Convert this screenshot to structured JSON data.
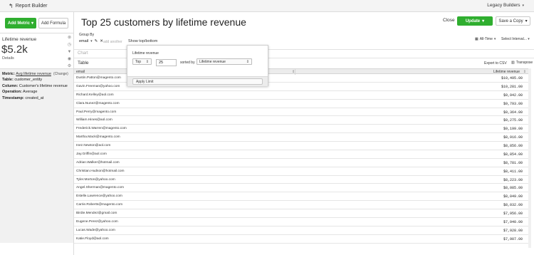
{
  "topbar": {
    "back_label": "Report Builder",
    "org_label": "Legacy Builders"
  },
  "sidebar": {
    "add_metric_label": "Add Metric",
    "add_formula_label": "Add Formula",
    "metric": {
      "name": "Lifetime revenue",
      "value": "$5.2k",
      "details_label": "Details"
    },
    "info": {
      "metric_label": "Metric:",
      "metric_value": "Avg lifetime revenue",
      "change_label": "(Change)",
      "table_label": "Table:",
      "table_value": "customer_entity",
      "column_label": "Column:",
      "column_value": "Customer's lifetime revenue",
      "operation_label": "Operation:",
      "operation_value": "Average",
      "timestamp_label": "Timestamp:",
      "timestamp_value": "created_at"
    }
  },
  "header": {
    "title": "Top 25 customers by lifetime revenue",
    "close_label": "Close",
    "update_label": "Update",
    "save_label": "Save a Copy"
  },
  "controls": {
    "groupby_label": "Group By",
    "groupby_value": "email",
    "add_another_label": "add another",
    "show_top_label": "Show top/bottom",
    "time_label": "All-Time",
    "interval_label": "Select Interval..."
  },
  "sections": {
    "chart_label": "Chart",
    "table_label": "Table",
    "export_label": "Export to CSV",
    "transpose_label": "Transpose"
  },
  "popover": {
    "title": "Lifetime revenue",
    "direction_value": "Top",
    "limit_value": "25",
    "sorted_by_label": "sorted by",
    "sort_value": "Lifetime revenue",
    "apply_label": "Apply Limit"
  },
  "table": {
    "columns": [
      "email",
      "Lifetime revenue"
    ],
    "rows": [
      [
        "Dustin.Patton@magento.com",
        "$10,495.00"
      ],
      [
        "Gavin.Freeman@yahoo.com",
        "$10,281.00"
      ],
      [
        "Richard.Kelley@aol.com",
        "$9,942.00"
      ],
      [
        "Clara.Nunez@magento.com",
        "$9,793.00"
      ],
      [
        "Paul.Perry@magento.com",
        "$9,364.00"
      ],
      [
        "William.Hines@aol.com",
        "$9,275.00"
      ],
      [
        "Frederick.Warren@magento.com",
        "$9,199.00"
      ],
      [
        "Martha.Mack@magento.com",
        "$8,916.00"
      ],
      [
        "Inez.Newton@aol.com",
        "$8,856.00"
      ],
      [
        "Jay.Griffin@aol.com",
        "$8,854.00"
      ],
      [
        "Adrian.Walker@hotmail.com",
        "$8,781.00"
      ],
      [
        "Christian.Hudson@hotmail.com",
        "$8,411.00"
      ],
      [
        "Tyler.Morton@yahoo.com",
        "$8,223.00"
      ],
      [
        "Angel.Sherman@magento.com",
        "$8,085.00"
      ],
      [
        "Estelle.Lawrence@yahoo.com",
        "$8,049.00"
      ],
      [
        "Carrie.Roberts@magento.com",
        "$8,032.00"
      ],
      [
        "Birdie.Mendez@gmail.com",
        "$7,956.00"
      ],
      [
        "Eugene.Perez@yahoo.com",
        "$7,940.00"
      ],
      [
        "Lucas.Wade@yahoo.com",
        "$7,928.00"
      ],
      [
        "Katie.Floyd@aol.com",
        "$7,907.00"
      ]
    ]
  },
  "colors": {
    "accent_green": "#2fae2f"
  }
}
